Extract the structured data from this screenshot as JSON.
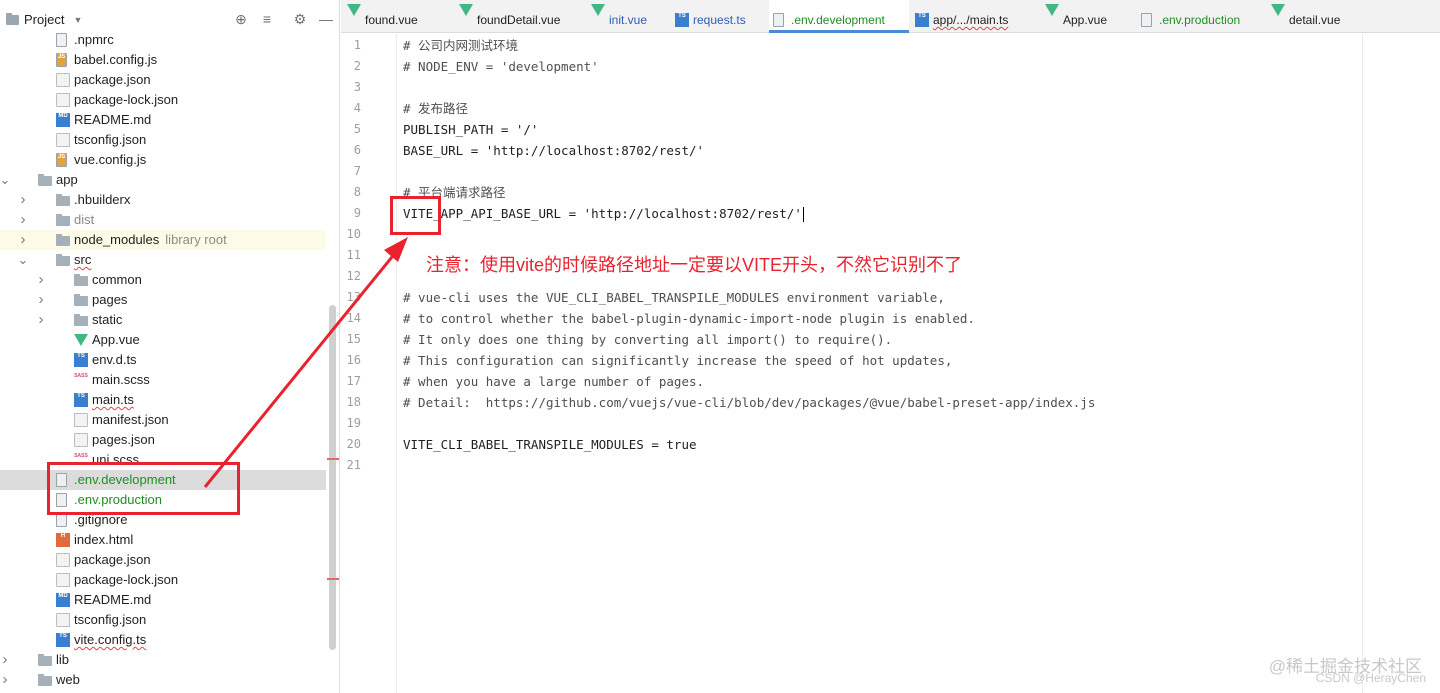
{
  "project_panel": {
    "title": "Project",
    "tree": [
      {
        "label": ".npmrc",
        "icon": "file",
        "depth": 1
      },
      {
        "label": "babel.config.js",
        "icon": "js",
        "depth": 1
      },
      {
        "label": "package.json",
        "icon": "json",
        "depth": 1
      },
      {
        "label": "package-lock.json",
        "icon": "json",
        "depth": 1
      },
      {
        "label": "README.md",
        "icon": "md",
        "depth": 1
      },
      {
        "label": "tsconfig.json",
        "icon": "json",
        "depth": 1
      },
      {
        "label": "vue.config.js",
        "icon": "js",
        "depth": 1
      },
      {
        "label": "app",
        "icon": "folder",
        "depth": 0,
        "expanded": true
      },
      {
        "label": ".hbuilderx",
        "icon": "folder",
        "depth": 1,
        "collapsed": true
      },
      {
        "label": "dist",
        "icon": "folder",
        "depth": 1,
        "collapsed": true,
        "dimmed": true
      },
      {
        "label": "node_modules",
        "suffix": "library root",
        "icon": "folder",
        "depth": 1,
        "collapsed": true,
        "lib_root": true
      },
      {
        "label": "src",
        "icon": "folder",
        "depth": 1,
        "expanded": true,
        "underline": true
      },
      {
        "label": "common",
        "icon": "folder",
        "depth": 2,
        "collapsed": true
      },
      {
        "label": "pages",
        "icon": "folder",
        "depth": 2,
        "collapsed": true
      },
      {
        "label": "static",
        "icon": "folder",
        "depth": 2,
        "collapsed": true
      },
      {
        "label": "App.vue",
        "icon": "vue",
        "depth": 2
      },
      {
        "label": "env.d.ts",
        "icon": "ts",
        "depth": 2
      },
      {
        "label": "main.scss",
        "icon": "sass",
        "depth": 2
      },
      {
        "label": "main.ts",
        "icon": "ts",
        "depth": 2,
        "underline": true
      },
      {
        "label": "manifest.json",
        "icon": "json",
        "depth": 2
      },
      {
        "label": "pages.json",
        "icon": "json",
        "depth": 2
      },
      {
        "label": "uni.scss",
        "icon": "sass",
        "depth": 2
      },
      {
        "label": ".env.development",
        "icon": "file",
        "depth": 1,
        "git_added": true,
        "selected": true
      },
      {
        "label": ".env.production",
        "icon": "file",
        "depth": 1,
        "git_added": true
      },
      {
        "label": ".gitignore",
        "icon": "file",
        "depth": 1
      },
      {
        "label": "index.html",
        "icon": "html",
        "depth": 1
      },
      {
        "label": "package.json",
        "icon": "json",
        "depth": 1
      },
      {
        "label": "package-lock.json",
        "icon": "json",
        "depth": 1
      },
      {
        "label": "README.md",
        "icon": "md",
        "depth": 1
      },
      {
        "label": "tsconfig.json",
        "icon": "json",
        "depth": 1
      },
      {
        "label": "vite.config.ts",
        "icon": "ts",
        "depth": 1,
        "underline": true
      },
      {
        "label": "lib",
        "icon": "folder",
        "depth": 0,
        "collapsed": true
      },
      {
        "label": "web",
        "icon": "folder",
        "depth": 0,
        "collapsed": true
      }
    ]
  },
  "tabs": [
    {
      "label": "found.vue",
      "icon": "vue"
    },
    {
      "label": "foundDetail.vue",
      "icon": "vue"
    },
    {
      "label": "init.vue",
      "icon": "vue",
      "style": "ts"
    },
    {
      "label": "request.ts",
      "icon": "ts",
      "style": "ts"
    },
    {
      "label": ".env.development",
      "icon": "file",
      "active": true
    },
    {
      "label": "app/.../main.ts",
      "icon": "ts",
      "underline": true
    },
    {
      "label": "App.vue",
      "icon": "vue"
    },
    {
      "label": ".env.production",
      "icon": "file",
      "style": "green"
    },
    {
      "label": "detail.vue",
      "icon": "vue"
    }
  ],
  "editor": {
    "lines": [
      "# 公司内网测试环境",
      "# NODE_ENV = 'development'",
      "",
      "# 发布路径",
      "PUBLISH_PATH = '/'",
      "BASE_URL = 'http://localhost:8702/rest/'",
      "",
      "# 平台端请求路径",
      "VITE_APP_API_BASE_URL = 'http://localhost:8702/rest/'",
      "",
      "",
      "",
      "# vue-cli uses the VUE_CLI_BABEL_TRANSPILE_MODULES environment variable,",
      "# to control whether the babel-plugin-dynamic-import-node plugin is enabled.",
      "# It only does one thing by converting all import() to require().",
      "# This configuration can significantly increase the speed of hot updates,",
      "# when you have a large number of pages.",
      "# Detail:  https://github.com/vuejs/vue-cli/blob/dev/packages/@vue/babel-preset-app/index.js",
      "",
      "VITE_CLI_BABEL_TRANSPILE_MODULES = true",
      ""
    ],
    "caret_line": 9
  },
  "annotation": {
    "note": "注意：使用vite的时候路径地址一定要以VITE开头，不然它识别不了",
    "color": "#e8222e"
  },
  "watermark": {
    "main": "@稀土掘金技术社区",
    "sub": "CSDN @HerayChen"
  },
  "colors": {
    "git_added": "#1f8f1f",
    "active_tab_underline": "#4a8bd6",
    "selection": "#dcdcdc"
  }
}
